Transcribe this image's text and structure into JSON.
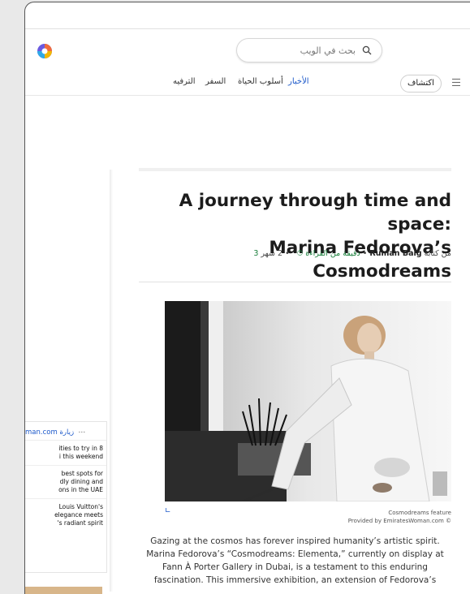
{
  "search": {
    "placeholder": "بحث في الويب",
    "icon": "search-icon"
  },
  "nav": {
    "discover": "اكتشاف",
    "news": "الأخبار",
    "lifestyle": "أسلوب الحياة",
    "travel": "السفر",
    "entertainment": "الترفيه",
    "accent": "#1a57c9"
  },
  "sidebar": {
    "header": "man.com زيارة",
    "items": [
      {
        "line1": "ities to try in 8",
        "line2": "i this weekend"
      },
      {
        "line1": "best spots for",
        "line2": "dly dining and",
        "line3": "ons in the UAE"
      },
      {
        "line1": "Louis Vuitton's",
        "line2": "elegance meets",
        "line3": "'s radiant spirit"
      }
    ]
  },
  "article": {
    "title_line1": "A journey through time and space:",
    "title_line2": "Marina Fedorova’s Cosmodreams",
    "byline_prefix": "من كتابة",
    "author": "Ruman Baig",
    "time_ago": "• 2 شهر •",
    "read_time": "3 دقيقة من القراءة",
    "caption_title": "Cosmodreams feature",
    "caption_provider": "Provided by EmiratesWoman.com ©",
    "body": "Gazing at the cosmos has forever inspired humanity’s artistic spirit. Marina Fedorova’s “Cosmodreams: Elementa,” currently on display at Fann À Porter Gallery in Dubai, is a testament to this enduring fascination. This immersive exhibition, an extension of Fedorova’s"
  }
}
